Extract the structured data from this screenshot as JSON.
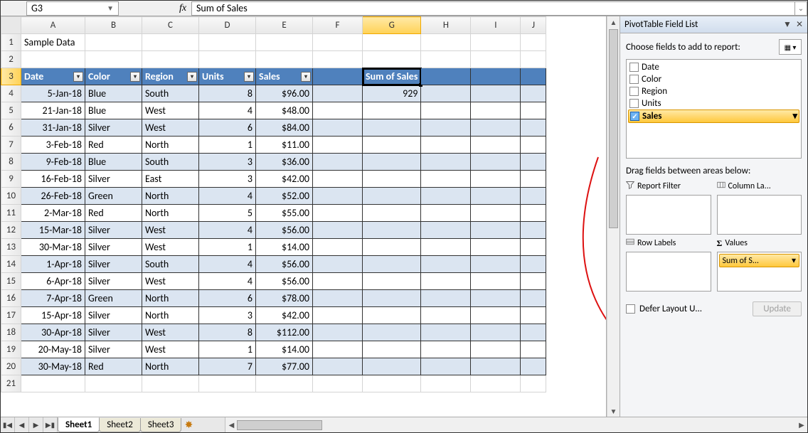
{
  "formula_bar": {
    "cell_ref": "G3",
    "fx_label": "fx",
    "formula_value": "Sum of Sales"
  },
  "columns": [
    "A",
    "B",
    "C",
    "D",
    "E",
    "F",
    "G",
    "H",
    "I",
    "J"
  ],
  "active_col": "G",
  "active_row": 3,
  "title_cell": "Sample Data",
  "headers": [
    "Date",
    "Color",
    "Region",
    "Units",
    "Sales"
  ],
  "rows": [
    {
      "date": "5-Jan-18",
      "color": "Blue",
      "region": "South",
      "units": 8,
      "sales": "$96.00"
    },
    {
      "date": "21-Jan-18",
      "color": "Blue",
      "region": "West",
      "units": 4,
      "sales": "$48.00"
    },
    {
      "date": "31-Jan-18",
      "color": "Silver",
      "region": "West",
      "units": 6,
      "sales": "$84.00"
    },
    {
      "date": "3-Feb-18",
      "color": "Red",
      "region": "North",
      "units": 1,
      "sales": "$11.00"
    },
    {
      "date": "9-Feb-18",
      "color": "Blue",
      "region": "South",
      "units": 3,
      "sales": "$36.00"
    },
    {
      "date": "16-Feb-18",
      "color": "Silver",
      "region": "East",
      "units": 3,
      "sales": "$42.00"
    },
    {
      "date": "26-Feb-18",
      "color": "Green",
      "region": "North",
      "units": 4,
      "sales": "$52.00"
    },
    {
      "date": "2-Mar-18",
      "color": "Red",
      "region": "North",
      "units": 5,
      "sales": "$55.00"
    },
    {
      "date": "15-Mar-18",
      "color": "Silver",
      "region": "West",
      "units": 4,
      "sales": "$56.00"
    },
    {
      "date": "30-Mar-18",
      "color": "Silver",
      "region": "West",
      "units": 1,
      "sales": "$14.00"
    },
    {
      "date": "1-Apr-18",
      "color": "Silver",
      "region": "South",
      "units": 4,
      "sales": "$56.00"
    },
    {
      "date": "6-Apr-18",
      "color": "Silver",
      "region": "West",
      "units": 4,
      "sales": "$56.00"
    },
    {
      "date": "7-Apr-18",
      "color": "Green",
      "region": "North",
      "units": 6,
      "sales": "$78.00"
    },
    {
      "date": "15-Apr-18",
      "color": "Silver",
      "region": "North",
      "units": 3,
      "sales": "$42.00"
    },
    {
      "date": "30-Apr-18",
      "color": "Silver",
      "region": "West",
      "units": 8,
      "sales": "$112.00"
    },
    {
      "date": "20-May-18",
      "color": "Silver",
      "region": "West",
      "units": 1,
      "sales": "$14.00"
    },
    {
      "date": "30-May-18",
      "color": "Red",
      "region": "North",
      "units": 7,
      "sales": "$77.00"
    }
  ],
  "pivot": {
    "label": "Sum of Sales",
    "value": "929"
  },
  "pane": {
    "title": "PivotTable Field List",
    "choose_label": "Choose fields to add to report:",
    "fields": [
      {
        "name": "Date",
        "checked": false
      },
      {
        "name": "Color",
        "checked": false
      },
      {
        "name": "Region",
        "checked": false
      },
      {
        "name": "Units",
        "checked": false
      },
      {
        "name": "Sales",
        "checked": true
      }
    ],
    "drag_label": "Drag fields between areas below:",
    "areas": {
      "filter": "Report Filter",
      "columns": "Column La...",
      "rows": "Row Labels",
      "values": "Values"
    },
    "values_item": "Sum of S...",
    "defer": "Defer Layout U...",
    "update": "Update"
  },
  "tabs": {
    "sheets": [
      "Sheet1",
      "Sheet2",
      "Sheet3"
    ],
    "active": 0
  },
  "colwidths": {
    "A": 90,
    "B": 80,
    "C": 80,
    "D": 80,
    "E": 80,
    "F": 70,
    "G": 78,
    "H": 70,
    "I": 70,
    "J": 36
  }
}
